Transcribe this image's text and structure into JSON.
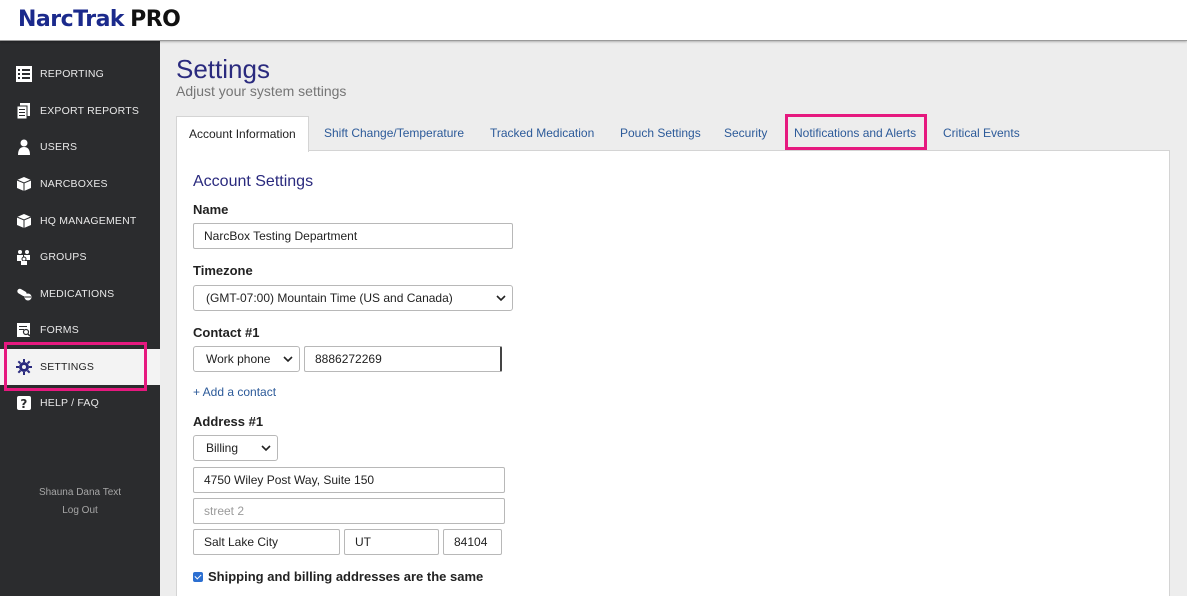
{
  "app": {
    "logo_part1": "NarcTrak",
    "logo_part2": "PRO"
  },
  "sidebar": {
    "items": [
      {
        "label": "REPORTING",
        "icon": "list-icon"
      },
      {
        "label": "EXPORT REPORTS",
        "icon": "export-icon"
      },
      {
        "label": "USERS",
        "icon": "user-icon"
      },
      {
        "label": "NARCBOXES",
        "icon": "box-icon"
      },
      {
        "label": "HQ MANAGEMENT",
        "icon": "box-icon"
      },
      {
        "label": "GROUPS",
        "icon": "group-icon"
      },
      {
        "label": "MEDICATIONS",
        "icon": "pill-icon"
      },
      {
        "label": "FORMS",
        "icon": "form-icon"
      },
      {
        "label": "SETTINGS",
        "icon": "gear-icon"
      },
      {
        "label": "HELP / FAQ",
        "icon": "help-icon"
      }
    ],
    "active": "SETTINGS",
    "user_name": "Shauna Dana Text",
    "logout_label": "Log Out"
  },
  "page": {
    "title": "Settings",
    "subtitle": "Adjust your system settings"
  },
  "tabs": [
    {
      "label": "Account Information"
    },
    {
      "label": "Shift Change/Temperature"
    },
    {
      "label": "Tracked Medication"
    },
    {
      "label": "Pouch Settings"
    },
    {
      "label": "Security"
    },
    {
      "label": "Notifications and Alerts"
    },
    {
      "label": "Critical Events"
    }
  ],
  "form": {
    "section_title": "Account Settings",
    "name_label": "Name",
    "name_value": "NarcBox Testing Department",
    "timezone_label": "Timezone",
    "timezone_value": "(GMT-07:00) Mountain Time (US and Canada)",
    "contact_label": "Contact #1",
    "contact_type": "Work phone",
    "contact_value": "8886272269",
    "add_contact": "+ Add a contact",
    "address_label": "Address #1",
    "address_type": "Billing",
    "street1": "4750 Wiley Post Way, Suite 150",
    "street2_placeholder": "street 2",
    "city": "Salt Lake City",
    "state": "UT",
    "zip": "84104",
    "same_address_label": "Shipping and billing addresses are the same"
  },
  "colors": {
    "accent": "#2a2a7e",
    "highlight": "#e6197f",
    "sidebar": "#2b2c2e"
  }
}
